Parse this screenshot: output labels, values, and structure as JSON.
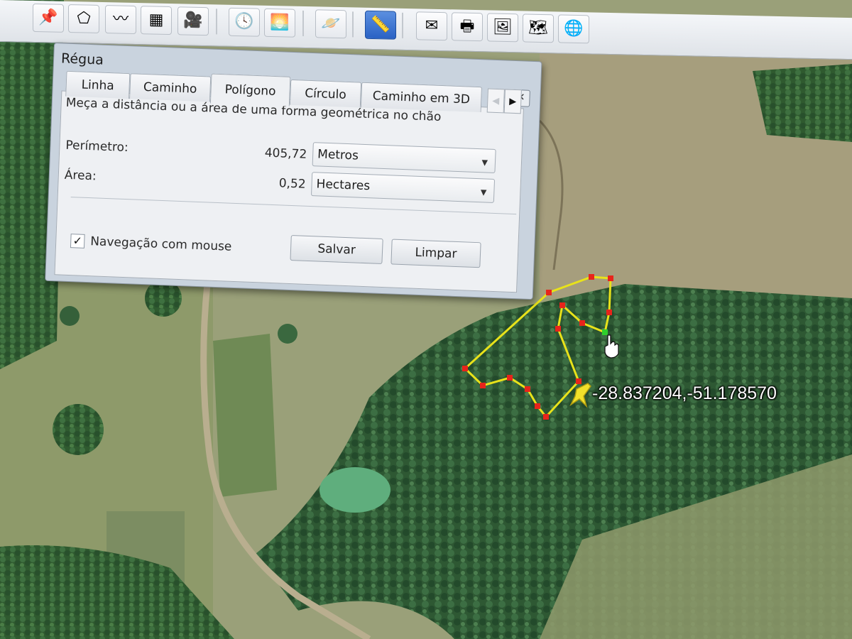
{
  "toolbar": {
    "buttons": [
      {
        "icon": "placemark-add-icon",
        "glyph": "📌"
      },
      {
        "icon": "polygon-add-icon",
        "glyph": "⬠"
      },
      {
        "icon": "path-add-icon",
        "glyph": "〰"
      },
      {
        "icon": "overlay-add-icon",
        "glyph": "▦"
      },
      {
        "icon": "tour-record-icon",
        "glyph": "🎥"
      },
      {
        "icon": "historical-imagery-icon",
        "glyph": "🕓"
      },
      {
        "icon": "sunlight-icon",
        "glyph": "🌅"
      },
      {
        "icon": "planets-icon",
        "glyph": "🪐"
      },
      {
        "icon": "ruler-icon",
        "glyph": "📏"
      },
      {
        "icon": "email-icon",
        "glyph": "✉"
      },
      {
        "icon": "print-icon",
        "glyph": "🖶"
      },
      {
        "icon": "save-image-icon",
        "glyph": "🖼"
      },
      {
        "icon": "view-in-maps-icon",
        "glyph": "🗺"
      },
      {
        "icon": "earth-icon",
        "glyph": "🌐"
      }
    ],
    "active": "ruler-icon"
  },
  "dialog": {
    "title": "Régua",
    "close_icon": "close-icon",
    "close_glyph": "✕",
    "tabs": [
      "Linha",
      "Caminho",
      "Polígono",
      "Círculo",
      "Caminho em 3D"
    ],
    "active_tab": "Polígono",
    "tab_prev_glyph": "◀",
    "tab_next_glyph": "▶",
    "description": "Meça a distância ou a área de uma forma geométrica no chão",
    "perimeter_label": "Perímetro:",
    "perimeter_value": "405,72",
    "perimeter_unit": "Metros",
    "area_label": "Área:",
    "area_value": "0,52",
    "area_unit": "Hectares",
    "dropdown_glyph": "▼",
    "mouse_nav_checked": true,
    "mouse_nav_check_glyph": "✓",
    "mouse_nav_label": "Navegação com mouse",
    "save_label": "Salvar",
    "clear_label": "Limpar"
  },
  "map": {
    "coordinate": "-28.837204,-51.178570",
    "pin_icon": "pushpin-icon",
    "cursor_icon": "hand-cursor-icon",
    "polygon_color": "#e8e21a",
    "vertex_color": "#e8241b",
    "active_vertex_color": "#2fd02b"
  }
}
